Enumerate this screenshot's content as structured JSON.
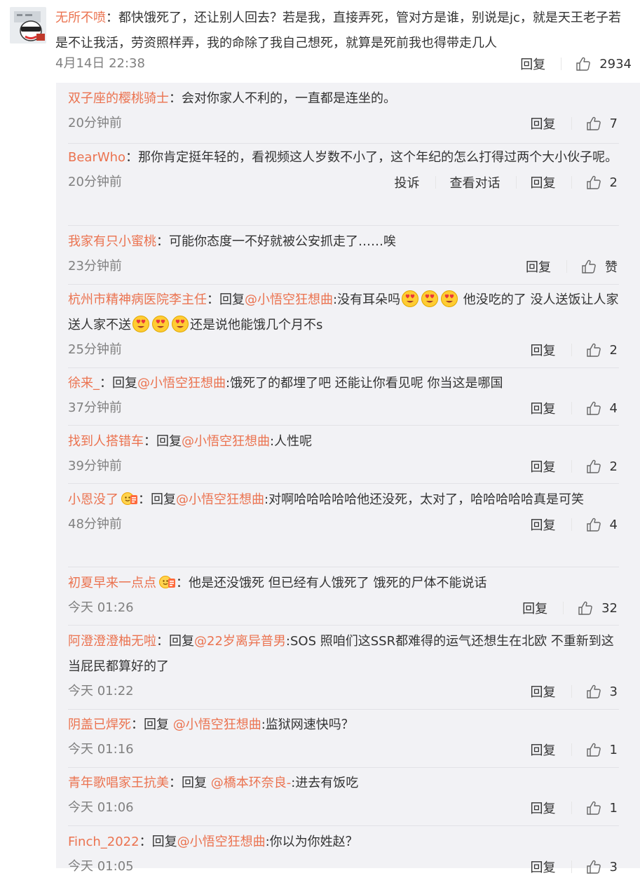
{
  "main_comment": {
    "user": "无所不喷",
    "text": "：都快饿死了，还让别人回去？若是我，直接弄死，管对方是谁，别说是jc，就是天王老子若是不让我活，劳资照样弄，我的命除了我自己想死，就算是死前我也得带走几人",
    "time": "4月14日 22:38",
    "reply_label": "回复",
    "likes": "2934"
  },
  "replies": [
    {
      "user": "双子座的樱桃骑士",
      "pre": "",
      "mention": "",
      "text": "：会对你家人不利的，一直都是连坐的。",
      "time": "20分钟前",
      "reply_label": "回复",
      "likes": "7"
    },
    {
      "user": "BearWho",
      "pre": "",
      "mention": "",
      "text": "：那你肯定挺年轻的，看视频这人岁数不小了，这个年纪的怎么打得过两个大小伙子呢。",
      "time": "20分钟前",
      "report_label": "投诉",
      "view_convo_label": "查看对话",
      "reply_label": "回复",
      "likes": "2"
    },
    {
      "user": "我家有只小蜜桃",
      "pre": "",
      "mention": "",
      "text": "：可能你态度一不好就被公安抓走了……唉",
      "time": "23分钟前",
      "reply_label": "回复",
      "likes": "赞"
    },
    {
      "user": "杭州市精神病医院李主任",
      "pre": "：回复",
      "mention": "@小悟空狂想曲",
      "text_a": ":没有耳朵吗",
      "text_b": " 他没吃的了 没人送饭让人家送人家不送",
      "text_c": "还是说他能饿几个月不s",
      "time": "25分钟前",
      "reply_label": "回复",
      "likes": "2",
      "emoji_icon": "heart-eyes-emoji"
    },
    {
      "user": "徐来_",
      "pre": "：回复",
      "mention": "@小悟空狂想曲",
      "text": ":饿死了的都埋了吧 还能让你看见呢 你当这是哪国",
      "time": "37分钟前",
      "reply_label": "回复",
      "likes": "4"
    },
    {
      "user": "找到人搭错车",
      "pre": "：回复",
      "mention": "@小悟空狂想曲",
      "text": ":人性呢",
      "time": "39分钟前",
      "reply_label": "回复",
      "likes": "2"
    },
    {
      "user": "小恩没了",
      "pre": "：回复",
      "mention": "@小悟空狂想曲",
      "text": ":对啊哈哈哈哈哈他还没死，太对了，哈哈哈哈哈真是可笑",
      "time": "48分钟前",
      "reply_label": "回复",
      "likes": "4",
      "badge_icon": "fan-badge-icon"
    },
    {
      "user": "初夏早来一点点",
      "pre": "",
      "mention": "",
      "text": "：他是还没饿死 但已经有人饿死了 饿死的尸体不能说话",
      "time": "今天 01:26",
      "reply_label": "回复",
      "likes": "32",
      "badge_icon": "fan-badge-icon"
    },
    {
      "user": "阿澄澄澄柚无啦",
      "pre": "：回复",
      "mention": "@22岁离异普男",
      "text": ":SOS 照咱们这SSR都难得的运气还想生在北欧 不重新到这当屁民都算好的了",
      "time": "今天 01:22",
      "reply_label": "回复",
      "likes": "3"
    },
    {
      "user": "阴盖已焊死",
      "pre": "：回复 ",
      "mention": "@小悟空狂想曲",
      "text": ":监狱网速快吗？",
      "time": "今天 01:16",
      "reply_label": "回复",
      "likes": "1"
    },
    {
      "user": "青年歌唱家王抗美",
      "pre": "：回复 ",
      "mention": "@橋本环奈良-",
      "text": ":进去有饭吃",
      "time": "今天 01:06",
      "reply_label": "回复",
      "likes": "1"
    },
    {
      "user": "Finch_2022",
      "pre": "：回复",
      "mention": "@小悟空狂想曲",
      "text": ":你以为你姓赵？",
      "time": "今天 01:05",
      "reply_label": "回复",
      "likes": "3"
    }
  ],
  "colors": {
    "username": "#eb7350",
    "text": "#333333",
    "meta": "#808080",
    "reply_bg": "#f2f2f5"
  }
}
